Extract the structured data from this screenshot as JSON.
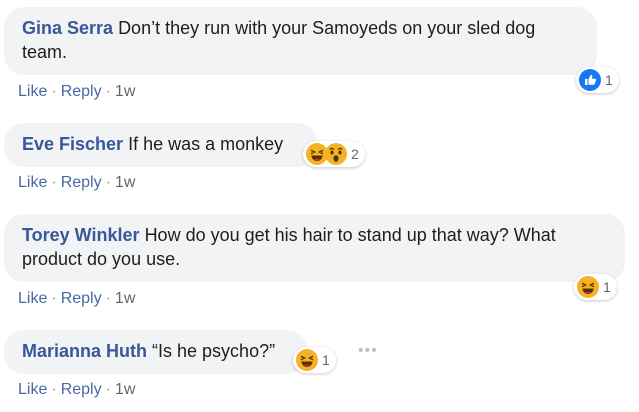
{
  "comments": [
    {
      "name": "Gina Serra",
      "text": "Don’t they run with your Samoyeds on your sled dog team.",
      "like": "Like",
      "reply": "Reply",
      "time": "1w",
      "reactions": {
        "icons": [
          "like-icon"
        ],
        "count": "1"
      }
    },
    {
      "name": "Eve Fischer",
      "text": "If he was a monkey",
      "like": "Like",
      "reply": "Reply",
      "time": "1w",
      "reactions": {
        "icons": [
          "haha-icon",
          "wow-icon"
        ],
        "count": "2"
      }
    },
    {
      "name": "Torey Winkler",
      "text": "How do you get his hair to stand up that way? What product do you use.",
      "like": "Like",
      "reply": "Reply",
      "time": "1w",
      "reactions": {
        "icons": [
          "haha-icon"
        ],
        "count": "1"
      }
    },
    {
      "name": "Marianna Huth",
      "text": "“Is he psycho?”",
      "like": "Like",
      "reply": "Reply",
      "time": "1w",
      "reactions": {
        "icons": [
          "haha-icon"
        ],
        "count": "1"
      },
      "more_icon": "more-horizontal-icon"
    }
  ],
  "separator": "·",
  "colors": {
    "name": "#385898",
    "bubble": "#f2f3f5",
    "like_reaction": "#1877f2",
    "emoji": "#f7b125"
  }
}
